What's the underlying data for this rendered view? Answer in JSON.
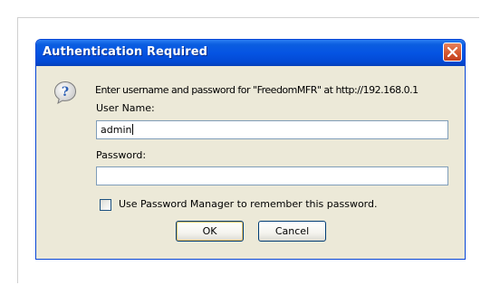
{
  "dialog": {
    "title": "Authentication Required",
    "message": "Enter username and password for \"FreedomMFR\" at http://192.168.0.1",
    "username_label": "User Name:",
    "username_value": "admin",
    "password_label": "Password:",
    "password_value": "",
    "remember_label": "Use Password Manager to remember this password.",
    "remember_checked": false,
    "ok_label": "OK",
    "cancel_label": "Cancel",
    "icons": {
      "close": "close-icon",
      "question": "question-icon"
    },
    "colors": {
      "titlebar": "#0554e3",
      "close_button": "#d5582f",
      "client_bg": "#ece9d8",
      "field_border": "#7f9db9"
    }
  }
}
